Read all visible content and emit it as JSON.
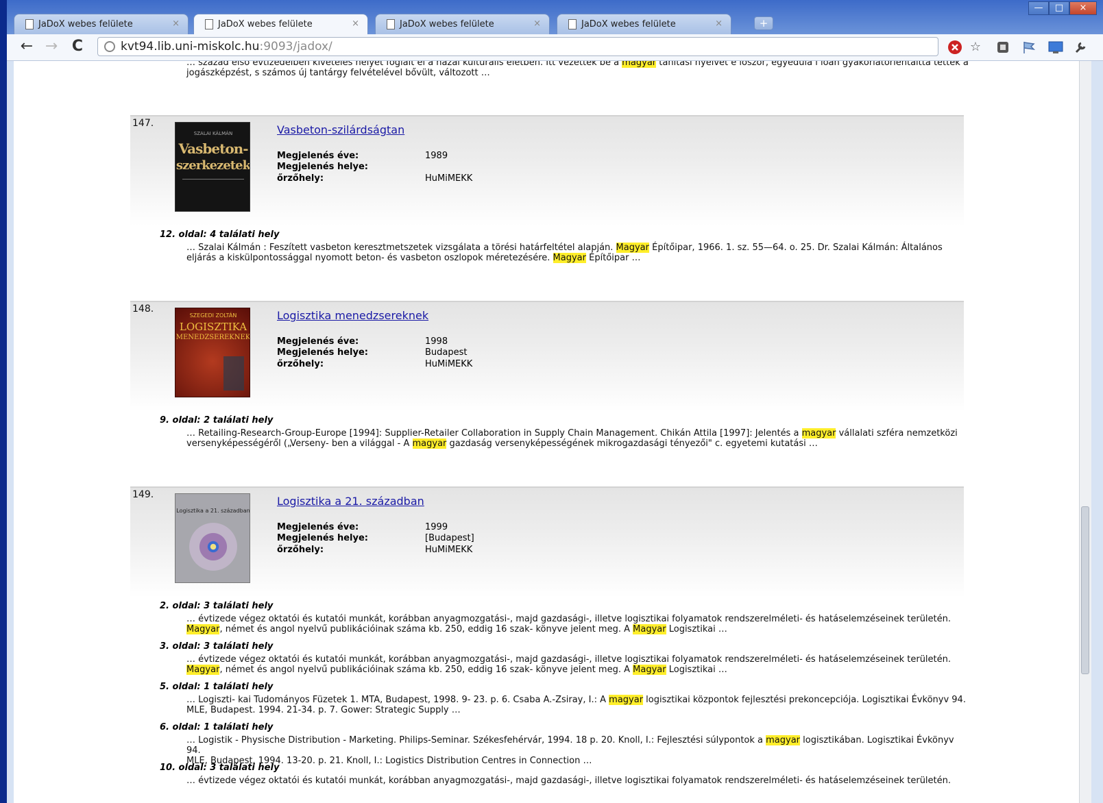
{
  "tabs": [
    {
      "title": "JaDoX webes felülete",
      "close": "×"
    },
    {
      "title": "JaDoX webes felülete",
      "close": "×"
    },
    {
      "title": "JaDoX webes felülete",
      "close": "×"
    },
    {
      "title": "JaDoX webes felülete",
      "close": "×"
    }
  ],
  "newtab_label": "+",
  "window_controls": {
    "minimize": "—",
    "maximize": "□",
    "close": "×"
  },
  "toolbar": {
    "back": "←",
    "forward": "→",
    "reload": "C",
    "url_host": "kvt94.lib.uni-miskolc.hu",
    "url_rest": ":9093/jadox/"
  },
  "top_snippet": {
    "a": "… század első évtizedeiben kivételes helyet foglalt el a hazai kulturális életben. Itt vezették be a ",
    "h1": "magyar",
    "b": " tanítási nyelvet e lőször, egyedülá l lóan gyakorlatorientálttá tették a",
    "c": "jogászképzést, s számos új tantárgy felvételével bővült, változott …"
  },
  "records": [
    {
      "number": "147.",
      "title": "Vasbeton-szilárdságtan",
      "labels": {
        "year": "Megjelenés éve:",
        "place": "Megjelenés helye:",
        "holder": "őrzőhely:"
      },
      "year": "1989",
      "place": "",
      "holder": "HuMiMEKK",
      "cover": {
        "author": "SZALAI KÁLMÁN",
        "line1": "Vasbeton-",
        "line2": "szerkezetek",
        "bg": "#141414",
        "fg": "#d8b870"
      },
      "hits": [
        {
          "page": "12. oldal: 4 találati hely",
          "l1a": "… Szalai Kálmán : Feszített vasbeton keresztmetszetek vizsgálata a törési határfeltétel alapján. ",
          "l1h": "Magyar",
          "l1b": " Építőipar, 1966. 1. sz. 55—64. o. 25. Dr. Szalai Kálmán: Általános",
          "l2a": "eljárás a kiskülpontossággal nyomott beton- és vasbeton oszlopok méretezésére. ",
          "l2h": "Magyar",
          "l2b": " Építőipar …"
        }
      ]
    },
    {
      "number": "148.",
      "title": "Logisztika menedzsereknek",
      "labels": {
        "year": "Megjelenés éve:",
        "place": "Megjelenés helye:",
        "holder": "őrzőhely:"
      },
      "year": "1998",
      "place": "Budapest",
      "holder": "HuMiMEKK",
      "cover": {
        "author": "SZEGEDI ZOLTÁN",
        "line1": "LOGISZTIKA",
        "line2": "MENEDZSEREKNEK",
        "bg": "#8a1c12",
        "fg": "#f0c040"
      },
      "hits": [
        {
          "page": "9. oldal: 2 találati hely",
          "l1a": "… Retailing-Research-Group-Europe [1994]: Supplier-Retailer Collaboration in Supply Chain Management. Chikán Attila [1997]: Jelentés a ",
          "l1h": "magyar",
          "l1b": " vállalati szféra nemzetközi",
          "l2a": "versenyképességéről („Verseny- ben a világgal - A ",
          "l2h": "magyar",
          "l2b": " gazdaság versenyképességének mikrogazdasági tényezői\" c. egyetemi kutatási …"
        }
      ]
    },
    {
      "number": "149.",
      "title": "Logisztika a 21. században",
      "labels": {
        "year": "Megjelenés éve:",
        "place": "Megjelenés helye:",
        "holder": "őrzőhely:"
      },
      "year": "1999",
      "place": "[Budapest]",
      "holder": "HuMiMEKK",
      "cover": {
        "author": "",
        "line1": "Logisztika a 21. században",
        "line2": "",
        "bg": "#a7a7ad",
        "fg": "#222"
      },
      "hits": [
        {
          "page": "2. oldal: 3 találati hely",
          "l1a": "… évtizede végez oktatói és kutatói munkát, korábban anyagmozgatási-, majd gazdasági-, illetve logisztikai folyamatok rendszerelméleti- és hatáselemzéseinek területén.",
          "l1h": "",
          "l1b": "",
          "l2a": "",
          "l2h": "Magyar",
          "l2b": ", német és angol nyelvű publikációinak száma kb. 250, eddig 16 szak- könyve jelent meg. A ",
          "l2h2": "Magyar",
          "l2c": " Logisztikai …"
        },
        {
          "page": "3. oldal: 3 találati hely",
          "l1a": "… évtizede végez oktatói és kutatói munkát, korábban anyagmozgatási-, majd gazdasági-, illetve logisztikai folyamatok rendszerelméleti- és hatáselemzéseinek területén.",
          "l1h": "",
          "l1b": "",
          "l2a": "",
          "l2h": "Magyar",
          "l2b": ", német és angol nyelvű publikációinak száma kb. 250, eddig 16 szak- könyve jelent meg. A ",
          "l2h2": "Magyar",
          "l2c": " Logisztikai …"
        },
        {
          "page": "5. oldal: 1 találati hely",
          "l1a": "… Logiszti- kai Tudományos Füzetek 1. MTA, Budapest, 1998. 9- 23. p. 6. Csaba A.-Zsiray, I.: A ",
          "l1h": "magyar",
          "l1b": " logisztikai központok fejlesztési prekoncepciója. Logisztikai Évkönyv 94.",
          "l2a": "MLE, Budapest. 1994. 21-34. p. 7. Gower: Strategic Supply …",
          "l2h": "",
          "l2b": "",
          "l2h2": "",
          "l2c": ""
        },
        {
          "page": "6. oldal: 1 találati hely",
          "l1a": "… Logistik - Physische Distribution - Marketing. Philips-Seminar. Székesfehérvár, 1994. 18 p. 20. Knoll, I.: Fejlesztési súlypontok a ",
          "l1h": "magyar",
          "l1b": " logisztikában. Logisztikai Évkönyv 94.",
          "l2a": "MLE, Budapest, 1994. 13-20. p. 21. Knoll, I.: Logistics Distribution Centres in Connection …",
          "l2h": "",
          "l2b": "",
          "l2h2": "",
          "l2c": ""
        },
        {
          "page": "10. oldal: 3 találati hely",
          "l1a": "… évtizede végez oktatói és kutatói munkát, korábban anyagmozgatási-, majd gazdasági-, illetve logisztikai folyamatok rendszerelméleti- és hatáselemzéseinek területén.",
          "l1h": "",
          "l1b": "",
          "l2a": "",
          "l2h": "",
          "l2b": "",
          "l2h2": "",
          "l2c": ""
        }
      ]
    }
  ],
  "colors": {
    "highlight": "#ffee2a",
    "link": "#1a1aa6",
    "frame": "#0b2a8c"
  }
}
